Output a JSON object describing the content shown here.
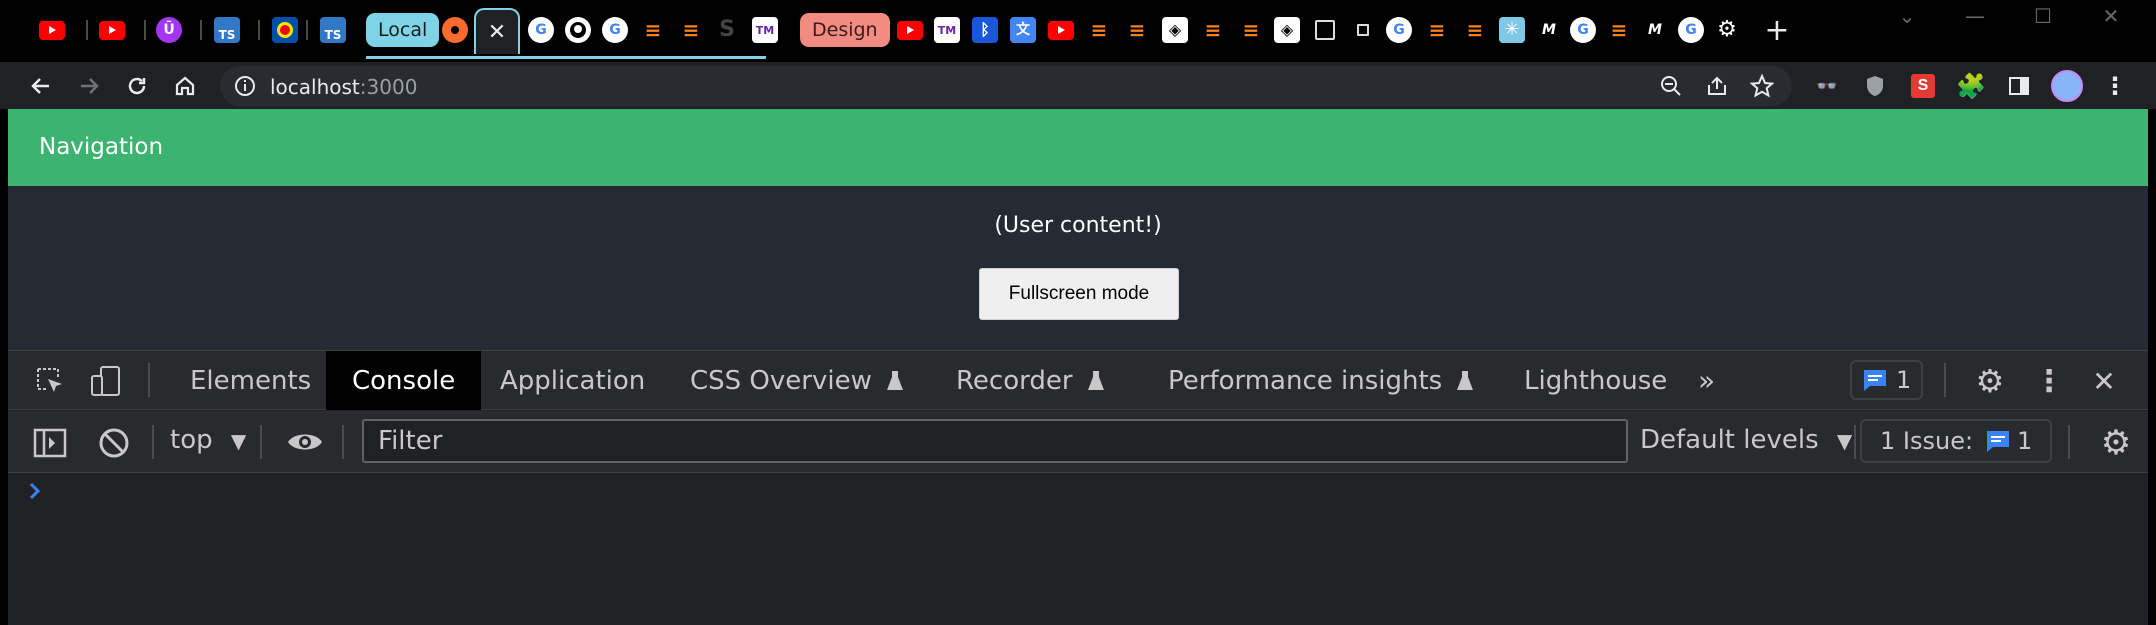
{
  "tabstrip": {
    "groups": [
      {
        "label": "Local",
        "color": "#7fd3e7",
        "text_color": "#1b1b1b"
      },
      {
        "label": "Design",
        "color": "#f28b82",
        "text_color": "#3b1b1b"
      }
    ],
    "ts_label": "TS",
    "new_tab": "+"
  },
  "toolbar": {
    "url_host": "localhost",
    "url_port": ":3000"
  },
  "page": {
    "nav_title": "Navigation",
    "user_content": "(User content!)",
    "fullscreen_button": "Fullscreen mode"
  },
  "devtools": {
    "tabs": [
      "Elements",
      "Console",
      "Application",
      "CSS Overview",
      "Recorder",
      "Performance insights",
      "Lighthouse"
    ],
    "active_tab": "Console",
    "messages_count": "1",
    "console": {
      "context": "top",
      "filter_placeholder": "Filter",
      "levels": "Default levels",
      "issues_label": "1 Issue:",
      "issues_count": "1"
    }
  },
  "colors": {
    "nav_green": "#3cb371",
    "page_bg": "#252a33",
    "devtools_bg": "#202124",
    "accent_blue": "#3b82f6"
  }
}
